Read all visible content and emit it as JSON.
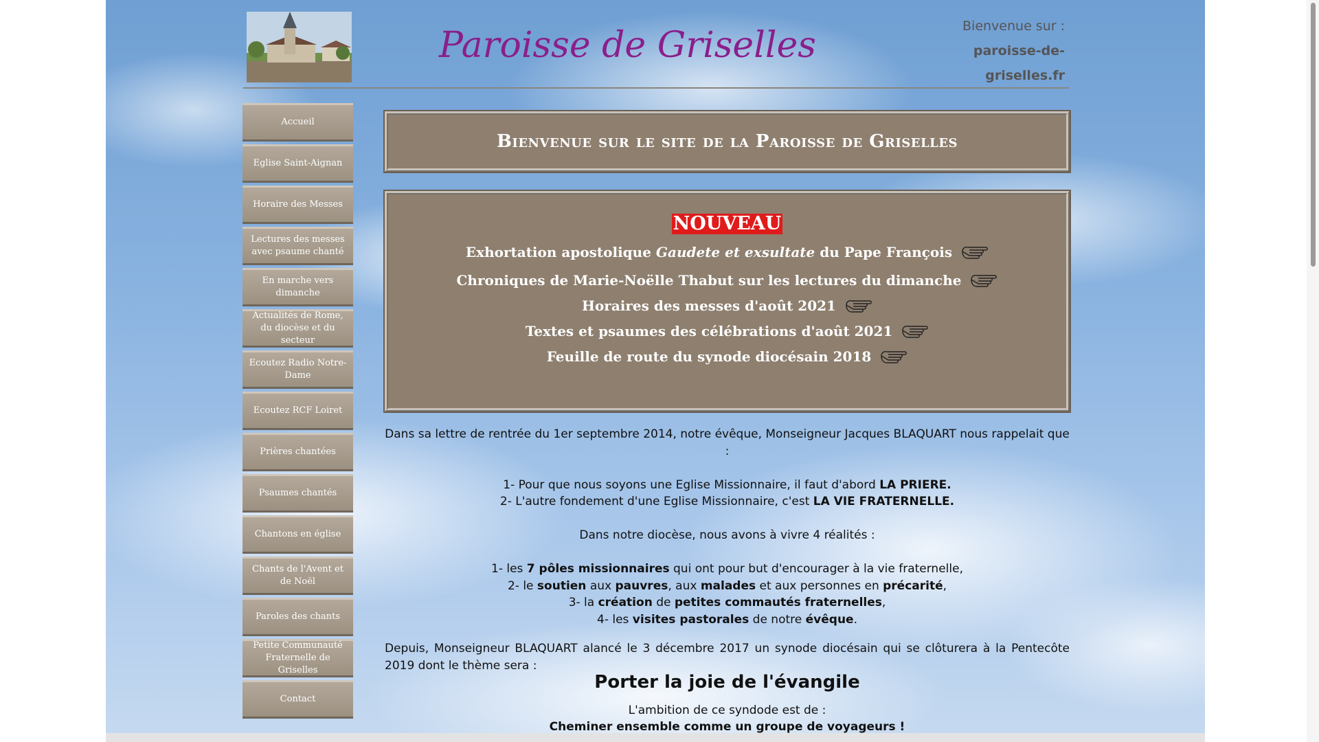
{
  "header": {
    "site_title": "Paroisse de Griselles",
    "welcome_label": "Bienvenue sur :",
    "domain_line1": "paroisse-de-",
    "domain_line2": "griselles.fr"
  },
  "nav": {
    "items": [
      {
        "label": "Accueil"
      },
      {
        "label": "Eglise Saint-Aignan"
      },
      {
        "label": "Horaire des Messes"
      },
      {
        "label": "Lectures des messes avec psaume chanté"
      },
      {
        "label": "En marche vers dimanche"
      },
      {
        "label": "Actualités de Rome, du diocèse et du secteur"
      },
      {
        "label": "Ecoutez Radio Notre-Dame"
      },
      {
        "label": "Ecoutez RCF Loiret"
      },
      {
        "label": "Prières chantées"
      },
      {
        "label": "Psaumes chantés"
      },
      {
        "label": "Chantons en église"
      },
      {
        "label": "Chants de l'Avent et de Noël"
      },
      {
        "label": "Paroles des chants"
      },
      {
        "label": "Petite Communauté Fraternelle de Griselles"
      },
      {
        "label": "Contact"
      }
    ]
  },
  "welcome_box": {
    "title": "Bienvenue sur le site de la Paroisse de Griselles"
  },
  "news": {
    "badge": "NOUVEAU",
    "link1_before": "Exhortation apostolique ",
    "link1_italic": "Gaudete et exsultate",
    "link1_after": " du Pape François",
    "link2": "Chroniques de Marie-Noëlle Thabut sur les lectures du dimanche",
    "link3": "Horaires des messes d'août 2021",
    "link4": "Textes et psaumes des célébrations d'août 2021",
    "link5": "Feuille de route du synode diocésain 2018"
  },
  "body": {
    "intro": "Dans sa lettre de rentrée du 1er septembre 2014, notre évêque, Monseigneur Jacques BLAQUART nous rappelait que :",
    "p1_a": "1- Pour que nous soyons une Eglise Missionnaire, il faut d'abord ",
    "p1_b": "LA PRIERE.",
    "p2_a": "2- L'autre fondement d'une Eglise Missionnaire, c'est ",
    "p2_b": "LA VIE FRATERNELLE.",
    "diocese": "Dans notre diocèse, nous avons à vivre 4 réalités :",
    "r1_a": "1- les ",
    "r1_b": "7 pôles missionnaires",
    "r1_c": " qui ont pour but d'encourager à la vie fraternelle,",
    "r2_a": "2- le ",
    "r2_b": "soutien",
    "r2_c": " aux ",
    "r2_d": "pauvres",
    "r2_e": ", aux ",
    "r2_f": "malades",
    "r2_g": " et aux personnes en ",
    "r2_h": "précarité",
    "r2_i": ",",
    "r3_a": "3- la ",
    "r3_b": "création",
    "r3_c": " de ",
    "r3_d": "petites commautés fraternelles",
    "r3_e": ",",
    "r4_a": "4- les ",
    "r4_b": "visites pastorales",
    "r4_c": " de notre ",
    "r4_d": "évêque",
    "r4_e": ".",
    "synode": "Depuis, Monseigneur BLAQUART alancé le 3 décembre 2017 un synode diocésain qui se clôturera à la Pentecôte 2019 dont le thème sera :",
    "theme": "Porter la joie de l'évangile",
    "ambition": "L'ambition de ce syndode est de :",
    "cut_line": "Cheminer ensemble comme un groupe de voyageurs !"
  }
}
